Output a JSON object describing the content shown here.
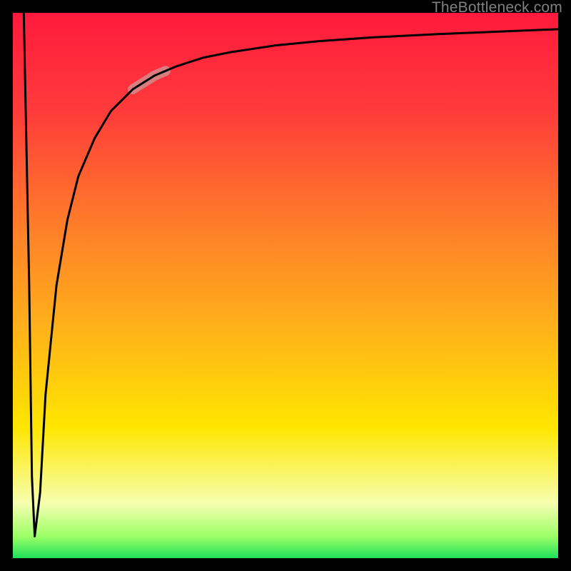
{
  "watermark": "TheBottleneck.com",
  "gradient": {
    "c0": "#ff1a3d",
    "c1": "#ff3b3b",
    "c2": "#ff7a2a",
    "c3": "#ffb21a",
    "c4": "#ffe600",
    "c5": "#f6ffb0",
    "c6": "#9cff66",
    "c7": "#1fe05a"
  },
  "chart_data": {
    "type": "line",
    "title": "",
    "xlabel": "",
    "ylabel": "",
    "xlim": [
      0,
      100
    ],
    "ylim": [
      0,
      100
    ],
    "series": [
      {
        "name": "curve",
        "x": [
          2.0,
          3.0,
          3.5,
          4.0,
          5.0,
          6.0,
          8.0,
          10.0,
          12.0,
          15.0,
          18.0,
          22.0,
          26.0,
          30.0,
          35.0,
          40.0,
          48.0,
          56.0,
          66.0,
          78.0,
          90.0,
          100.0
        ],
        "y": [
          100.0,
          50.0,
          15.0,
          4.0,
          12.0,
          30.0,
          50.0,
          62.0,
          70.0,
          77.0,
          82.0,
          86.0,
          88.5,
          90.2,
          91.8,
          92.8,
          94.0,
          94.8,
          95.5,
          96.1,
          96.6,
          97.0
        ]
      }
    ],
    "highlight_segment": {
      "series": "curve",
      "x_start": 22.0,
      "x_end": 28.0
    },
    "annotations": []
  }
}
